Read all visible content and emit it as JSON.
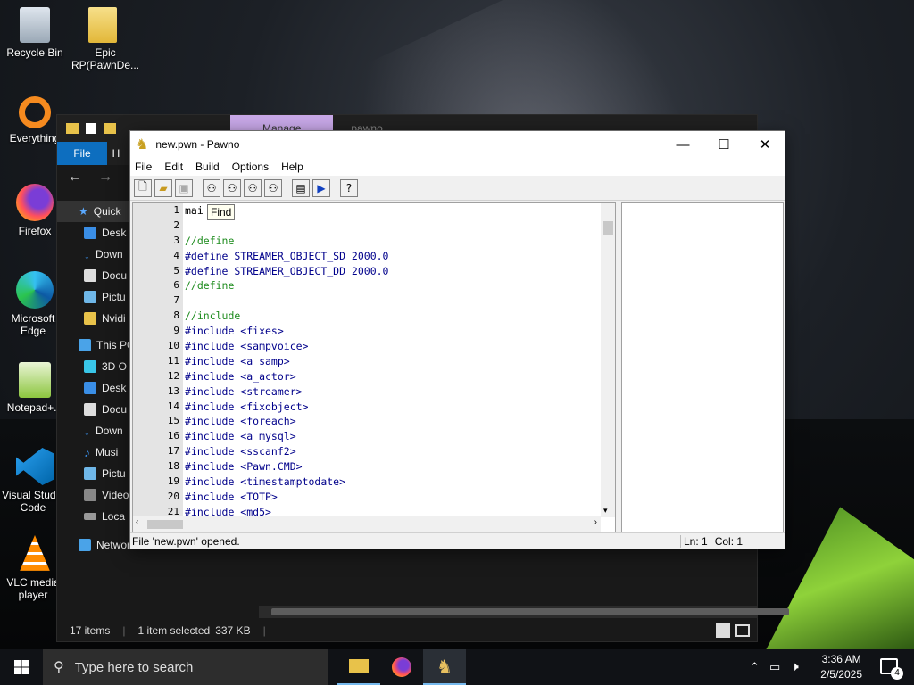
{
  "desktop": {
    "icons": [
      {
        "label": "Recycle Bin"
      },
      {
        "label": "Epic RP(PawnDe..."
      },
      {
        "label": "Everything"
      },
      {
        "label": "Firefox"
      },
      {
        "label": "Microsoft Edge"
      },
      {
        "label": "Notepad+..."
      },
      {
        "label": "Visual Studio Code"
      },
      {
        "label": "VLC media player"
      }
    ]
  },
  "explorer": {
    "tab_partial": "Manage",
    "tab_partial2": "pawno",
    "ribbon": {
      "file": "File",
      "home": "H"
    },
    "sidebar": [
      {
        "label": "Quick"
      },
      {
        "label": "Desk"
      },
      {
        "label": "Down"
      },
      {
        "label": "Docu"
      },
      {
        "label": "Pictu"
      },
      {
        "label": "Nvidi"
      },
      {
        "label": "This PC"
      },
      {
        "label": "3D O"
      },
      {
        "label": "Desk"
      },
      {
        "label": "Docu"
      },
      {
        "label": "Down"
      },
      {
        "label": "Musi"
      },
      {
        "label": "Pictu"
      },
      {
        "label": "Video"
      },
      {
        "label": "Loca"
      },
      {
        "label": "Network"
      }
    ],
    "status": {
      "items": "17 items",
      "selected": "1 item selected",
      "size": "337 KB"
    }
  },
  "pawno": {
    "title": "new.pwn - Pawno",
    "menu": [
      "File",
      "Edit",
      "Build",
      "Options",
      "Help"
    ],
    "tooltip": "Find",
    "line_numbers": [
      "1",
      "2",
      "3",
      "4",
      "5",
      "6",
      "7",
      "8",
      "9",
      "10",
      "11",
      "12",
      "13",
      "14",
      "15",
      "16",
      "17",
      "18",
      "19",
      "20",
      "21"
    ],
    "code": [
      "mai  {}",
      "",
      "//define",
      "#define STREAMER_OBJECT_SD 2000.0",
      "#define STREAMER_OBJECT_DD 2000.0",
      "//define",
      "",
      "//include",
      "#include <fixes>",
      "#include <sampvoice>",
      "#include <a_samp>",
      "#include <a_actor>",
      "#include <streamer>",
      "#include <fixobject>",
      "#include <foreach>",
      "#include <a_mysql>",
      "#include <sscanf2>",
      "#include <Pawn.CMD>",
      "#include <timestamptodate>",
      "#include <TOTP>",
      "#include <md5>"
    ],
    "status": {
      "message": "File 'new.pwn' opened.",
      "line": "Ln: 1",
      "col": "Col: 1"
    }
  },
  "taskbar": {
    "search_placeholder": "Type here to search",
    "time": "3:36 AM",
    "date": "2/5/2025",
    "notifications": "4"
  },
  "colors": {
    "accent": "#0d6ebf",
    "preproc": "#00008b",
    "comment": "#1e8c1e"
  }
}
